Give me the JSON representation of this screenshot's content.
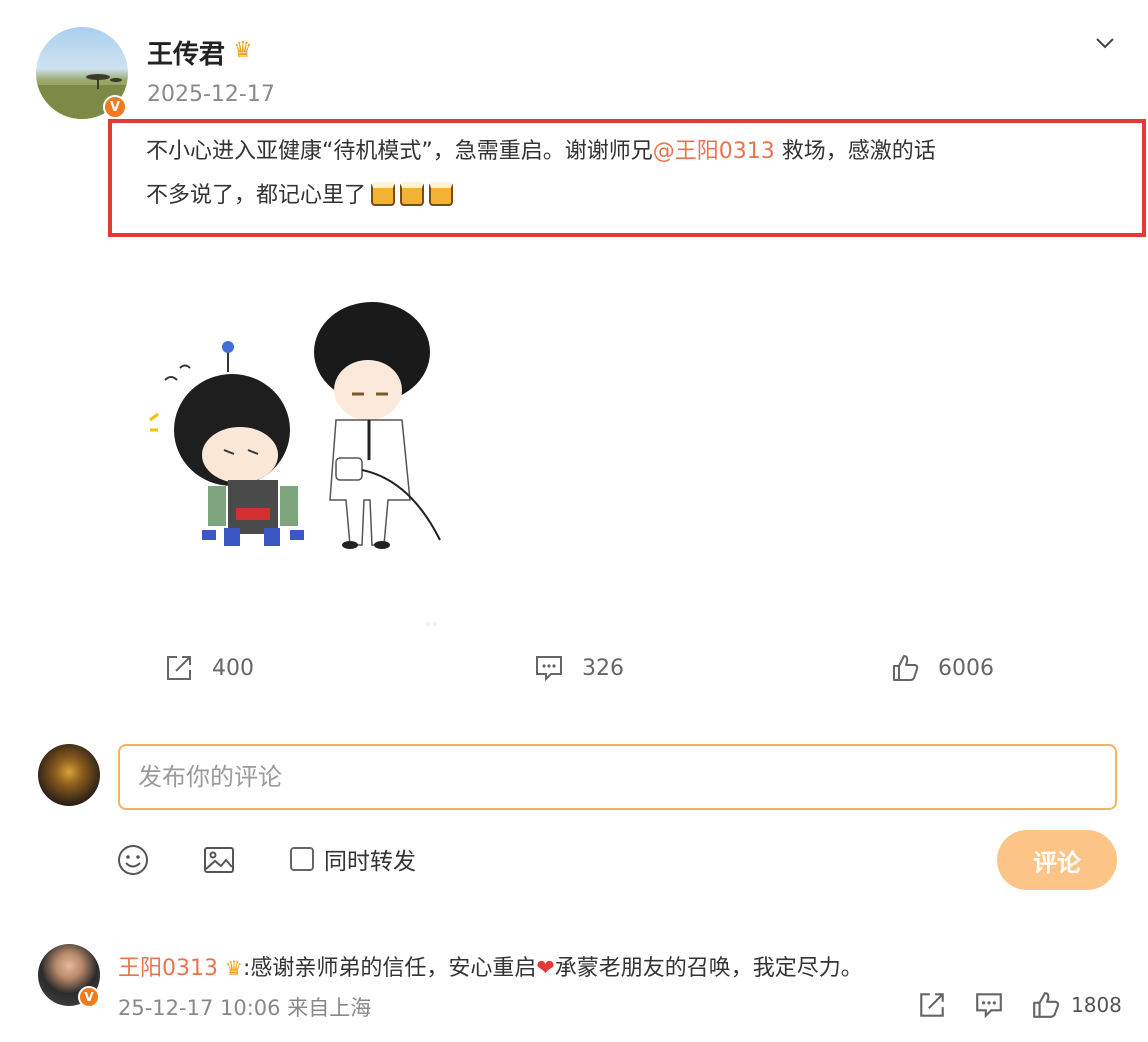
{
  "post": {
    "author": "王传君",
    "date": "2025-12-17",
    "text_1": "不小心进入亚健康“待机模式”，急需重启。谢谢师兄",
    "mention": "@王阳0313",
    "text_2": " 救场，感激的话",
    "text_3": "不多说了，都记心里了"
  },
  "actions": {
    "repost_count": "400",
    "comment_count": "326",
    "like_count": "6006"
  },
  "composer": {
    "placeholder": "发布你的评论",
    "repost_label": "同时转发",
    "submit_label": "评论"
  },
  "reply": {
    "author": "王阳0313",
    "text_1": ":感谢亲师弟的信任，安心重启",
    "text_2": "承蒙老朋友的召唤，我定尽力。",
    "meta": "25-12-17 10:06 来自上海",
    "like_count": "1808"
  },
  "colors": {
    "accent": "#eb7350",
    "highlight_border": "#e53935",
    "input_border": "#f5b35b",
    "submit_bg": "#fcc486",
    "verified_badge": "#f07a1e"
  },
  "icons": [
    "chevron-down-icon",
    "crown-icon",
    "beer-icon",
    "repost-icon",
    "comment-icon",
    "like-icon",
    "emoji-icon",
    "image-icon",
    "heart-icon"
  ]
}
